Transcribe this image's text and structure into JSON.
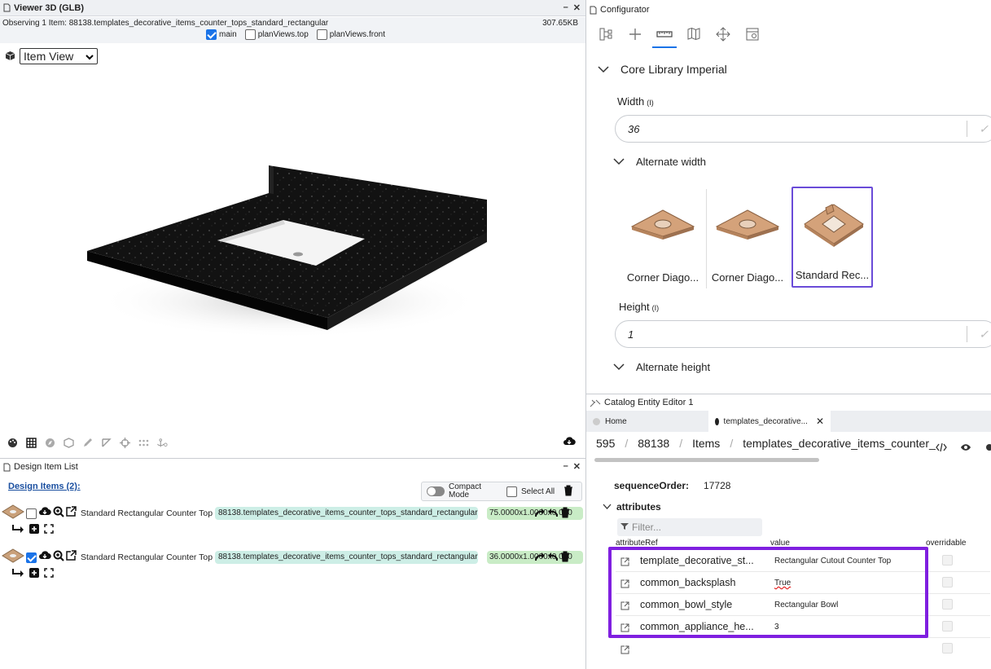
{
  "viewer": {
    "title": "Viewer 3D (GLB)",
    "min": "–",
    "close": "✕",
    "status_text": "Observing 1 Item: 88138.templates_decorative_items_counter_tops_standard_rectangular",
    "file_size": "307.65KB",
    "view_checkboxes": [
      {
        "label": "main",
        "checked": true
      },
      {
        "label": "planViews.top",
        "checked": false
      },
      {
        "label": "planViews.front",
        "checked": false
      }
    ],
    "view_mode": "Item View"
  },
  "design_list": {
    "title": "Design Item List",
    "min": "–",
    "close": "✕",
    "items_link": "Design Items (2):",
    "compact_mode_label": "Compact Mode",
    "select_all_label": "Select All",
    "items": [
      {
        "checked": false,
        "name": "Standard Rectangular Counter Top",
        "ref": "88138.templates_decorative_items_counter_tops_standard_rectangular",
        "dims": "75.0000x1.0000x0.000"
      },
      {
        "checked": true,
        "name": "Standard Rectangular Counter Top",
        "ref": "88138.templates_decorative_items_counter_tops_standard_rectangular",
        "dims": "36.0000x1.0000x0.000"
      }
    ]
  },
  "configurator": {
    "title": "Configurator",
    "library_title": "Core Library Imperial",
    "width_label": "Width",
    "width_hint": "(I)",
    "width_value": "36",
    "alt_width_label": "Alternate width",
    "alternates": [
      {
        "label": "Corner Diago...",
        "selected": false
      },
      {
        "label": "Corner Diago...",
        "selected": false
      },
      {
        "label": "Standard Rec...",
        "selected": true
      }
    ],
    "height_label": "Height",
    "height_hint": "(I)",
    "height_value": "1",
    "alt_height_label": "Alternate height"
  },
  "catalog": {
    "title": "Catalog Entity Editor 1",
    "tab_home": "Home",
    "tab_active": "templates_decorative...",
    "tab_close": "✕",
    "breadcrumb": [
      "595",
      "88138",
      "Items",
      "templates_decorative_items_counter_"
    ],
    "sequence_key": "sequenceOrder:",
    "sequence_value": "17728",
    "attributes_label": "attributes",
    "filter_placeholder": "Filter...",
    "columns": {
      "ref": "attributeRef",
      "value": "value",
      "overridable": "overridable"
    },
    "rows": [
      {
        "ref": "template_decorative_st...",
        "value": "Rectangular Cutout Counter Top"
      },
      {
        "ref": "common_backsplash",
        "value": "True"
      },
      {
        "ref": "common_bowl_style",
        "value": "Rectangular Bowl"
      },
      {
        "ref": "common_appliance_he...",
        "value": "3"
      },
      {
        "ref": "",
        "value": ""
      }
    ]
  },
  "colors": {
    "accent": "#1a73e8",
    "highlight": "#7f1fe0",
    "ref_chip": "#cdeee6",
    "dim_chip": "#c9ecc6",
    "countertop": "#111111"
  }
}
